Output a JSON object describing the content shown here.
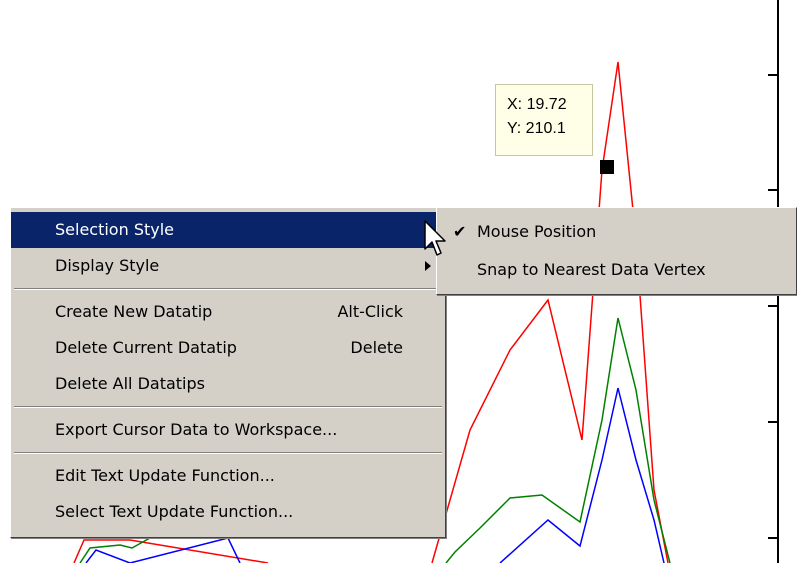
{
  "datatip": {
    "x_line": "X: 19.72",
    "y_line": "Y: 210.1"
  },
  "context_menu": {
    "items": [
      {
        "label": "Selection Style",
        "has_submenu": true,
        "highlighted": true
      },
      {
        "label": "Display Style",
        "has_submenu": true
      },
      {
        "label": "Create New Datatip",
        "shortcut": "Alt-Click"
      },
      {
        "label": "Delete Current Datatip",
        "shortcut": "Delete"
      },
      {
        "label": "Delete All Datatips"
      },
      {
        "label": "Export Cursor Data to Workspace..."
      },
      {
        "label": "Edit Text Update Function..."
      },
      {
        "label": "Select Text Update Function..."
      }
    ]
  },
  "submenu": {
    "items": [
      {
        "label": "Mouse Position",
        "checked": true,
        "check_glyph": "✔"
      },
      {
        "label": "Snap to Nearest Data Vertex",
        "checked": false
      }
    ]
  },
  "colors": {
    "menu_background": "#d4d0c8",
    "highlight": "#0a246a",
    "datatip_background": "#ffffe8",
    "red_series": "#ff0000",
    "green_series": "#008000",
    "blue_series": "#0000ff"
  },
  "icons": {
    "cursor": "arrow-cursor-icon",
    "check": "check-icon",
    "submenu_arrow": "submenu-arrow-icon"
  }
}
